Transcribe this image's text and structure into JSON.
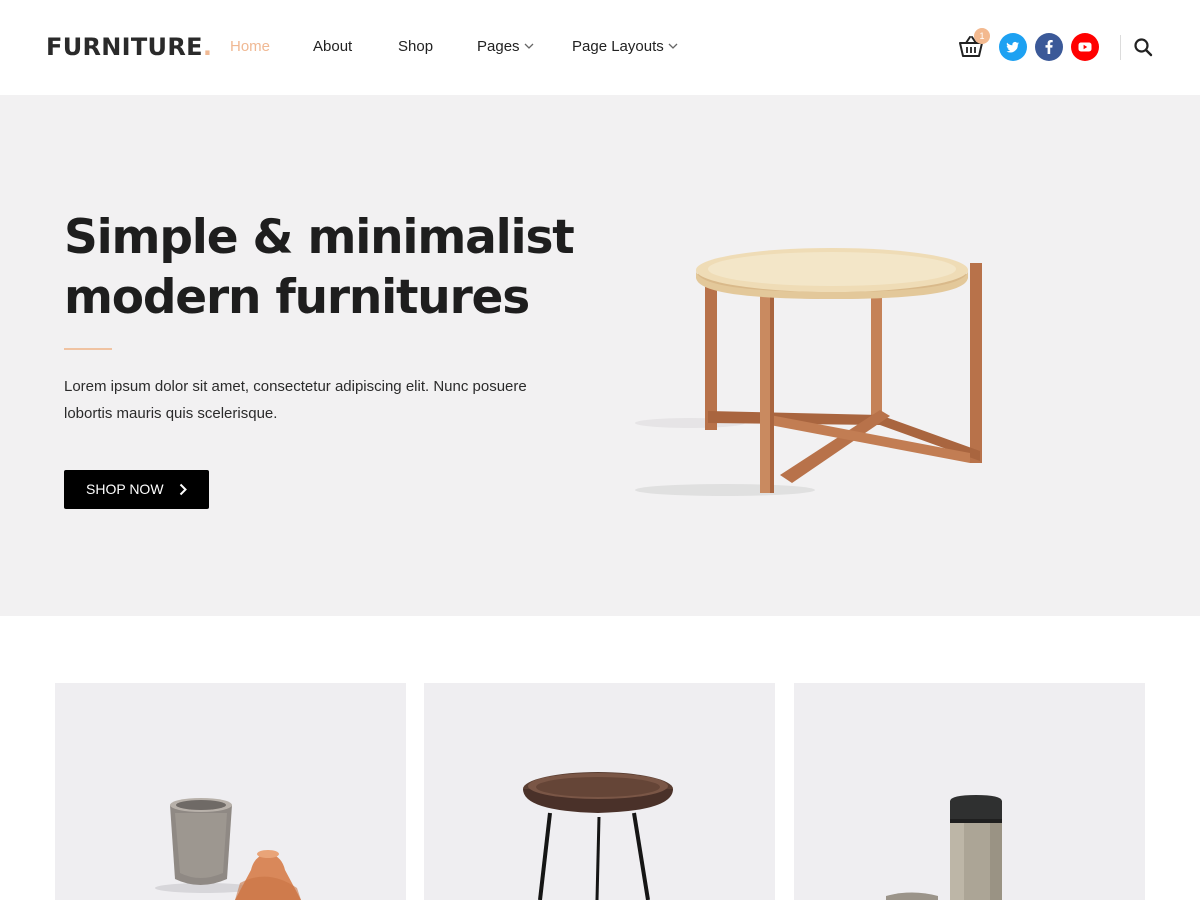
{
  "header": {
    "logo_text": "FURNITURE",
    "logo_dot": ".",
    "nav": [
      {
        "label": "Home",
        "active": true
      },
      {
        "label": "About"
      },
      {
        "label": "Shop"
      },
      {
        "label": "Pages",
        "has_dropdown": true
      },
      {
        "label": "Page Layouts",
        "has_dropdown": true
      }
    ],
    "cart_count": "1",
    "icons": [
      "cart-icon",
      "twitter-icon",
      "facebook-icon",
      "youtube-icon",
      "search-icon"
    ]
  },
  "hero": {
    "title_line1": "Simple & minimalist",
    "title_line2": "modern furnitures",
    "description_line1": "Lorem ipsum dolor sit amet, consectetur adipiscing elit. Nunc posuere",
    "description_line2": "lobortis mauris quis scelerisque.",
    "button_label": "SHOP NOW"
  },
  "colors": {
    "accent": "#f0b994",
    "hero_bg": "#f2f1f2",
    "button_bg": "#000000",
    "twitter": "#1da1f2",
    "facebook": "#3b5998",
    "youtube": "#ff0000"
  }
}
